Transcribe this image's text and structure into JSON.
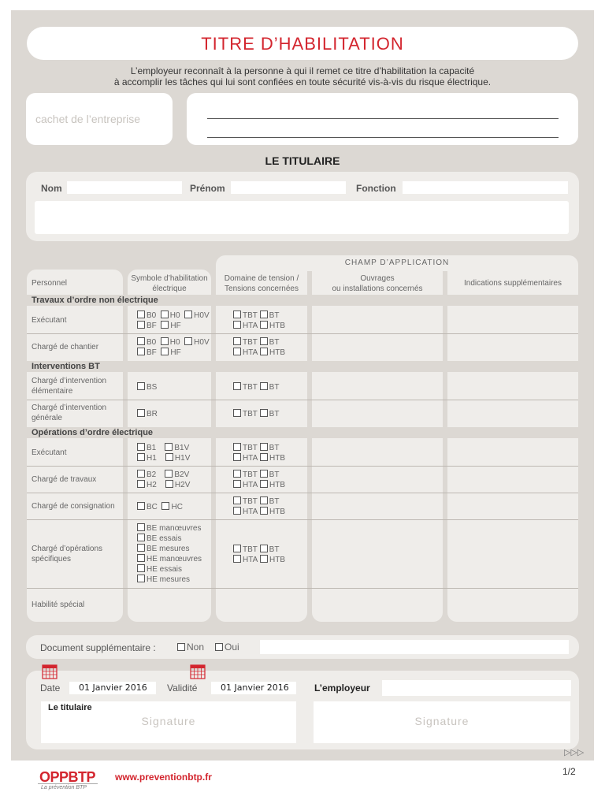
{
  "title": "TITRE D’HABILITATION",
  "intro": {
    "line1": "L’employeur reconnaît à la personne à qui il remet ce titre d’habilitation la capacité",
    "line2": "à accomplir les tâches qui lui sont confiées en toute sécurité vis-à-vis du risque électrique."
  },
  "cachet_label": "cachet de l’entreprise",
  "titulaire_section": {
    "heading": "LE TITULAIRE",
    "nom_label": "Nom",
    "prenom_label": "Prénom",
    "fonction_label": "Fonction"
  },
  "table": {
    "champ_header": "CHAMP D’APPLICATION",
    "col_personnel": "Personnel",
    "col_symbole_1": "Symbole d’habilitation",
    "col_symbole_2": "électrique",
    "col_domaine_1": "Domaine de tension /",
    "col_domaine_2": "Tensions concernées",
    "col_ouvrages_1": "Ouvrages",
    "col_ouvrages_2": "ou installations concernés",
    "col_indications": "Indications supplémentaires",
    "group1": "Travaux d’ordre non électrique",
    "group2": "Interventions BT",
    "group3": "Opérations d’ordre électrique",
    "r_executant": "Exécutant",
    "r_chantier": "Chargé de chantier",
    "r_interv_elem_1": "Chargé d’intervention",
    "r_interv_elem_2": "élémentaire",
    "r_interv_gen_1": "Chargé d’intervention",
    "r_interv_gen_2": "générale",
    "r_executant2": "Exécutant",
    "r_travaux": "Chargé de travaux",
    "r_consignation": "Chargé de consignation",
    "r_ops_1": "Chargé d’opérations",
    "r_ops_2": "spécifiques",
    "r_special": "Habilité spécial",
    "sym": {
      "B0": "B0",
      "H0": "H0",
      "H0V": "H0V",
      "BF": "BF",
      "HF": "HF",
      "BS": "BS",
      "BR": "BR",
      "B1": "B1",
      "B1V": "B1V",
      "H1": "H1",
      "H1V": "H1V",
      "B2": "B2",
      "B2V": "B2V",
      "H2": "H2",
      "H2V": "H2V",
      "BC": "BC",
      "HC": "HC",
      "BE_man": "BE manœuvres",
      "BE_ess": "BE essais",
      "BE_mes": "BE mesures",
      "HE_man": "HE manœuvres",
      "HE_ess": "HE essais",
      "HE_mes": "HE mesures"
    },
    "tens": {
      "TBT": "TBT",
      "BT": "BT",
      "HTA": "HTA",
      "HTB": "HTB"
    }
  },
  "doc_supp": {
    "label": "Document supplémentaire :",
    "non": "Non",
    "oui": "Oui"
  },
  "dates": {
    "date_label": "Date",
    "date_value": "01 Janvier 2016",
    "validite_label": "Validité",
    "validite_value": "01 Janvier 2016",
    "employeur_label": "L’employeur",
    "titulaire_label": "Le titulaire",
    "signature": "Signature"
  },
  "footer": {
    "logo": "OPPBTP",
    "tagline": "La prévention BTP",
    "url": "www.preventionbtp.fr",
    "page": "1/2",
    "arrows": "▷▷▷"
  },
  "colors": {
    "accent": "#d3252e",
    "sheet": "#dcd8d3",
    "panel": "#efedea"
  }
}
